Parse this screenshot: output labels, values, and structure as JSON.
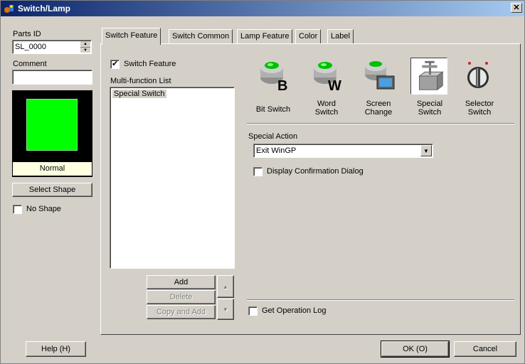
{
  "window": {
    "title": "Switch/Lamp",
    "close_glyph": "✕"
  },
  "left": {
    "parts_id_label": "Parts ID",
    "parts_id_value": "SL_0000",
    "comment_label": "Comment",
    "comment_value": "",
    "preview_color": "#00ff00",
    "preview_state": "Normal",
    "select_shape": "Select Shape",
    "no_shape": "No Shape"
  },
  "tabs": [
    {
      "label": "Switch Feature",
      "active": true
    },
    {
      "label": "Switch Common"
    },
    {
      "label": "Lamp Feature"
    },
    {
      "label": "Color"
    },
    {
      "label": "Label"
    }
  ],
  "feature": {
    "switch_feature_label": "Switch Feature",
    "switch_feature_checked": true,
    "multi_function_label": "Multi-function List",
    "multi_function_items": [
      "Special Switch"
    ],
    "add": "Add",
    "delete": "Delete",
    "copy_and_add": "Copy and Add"
  },
  "switch_types": [
    {
      "line1": "Bit Switch",
      "line2": "",
      "icon": "bit-switch-icon"
    },
    {
      "line1": "Word",
      "line2": "Switch",
      "icon": "word-switch-icon"
    },
    {
      "line1": "Screen",
      "line2": "Change",
      "icon": "screen-change-icon"
    },
    {
      "line1": "Special",
      "line2": "Switch",
      "icon": "special-switch-icon",
      "selected": true
    },
    {
      "line1": "Selector",
      "line2": "Switch",
      "icon": "selector-switch-icon"
    }
  ],
  "special": {
    "action_label": "Special Action",
    "action_value": "Exit WinGP",
    "confirm_label": "Display Confirmation Dialog",
    "log_label": "Get Operation Log"
  },
  "footer": {
    "help": "Help (H)",
    "ok": "OK (O)",
    "cancel": "Cancel"
  }
}
